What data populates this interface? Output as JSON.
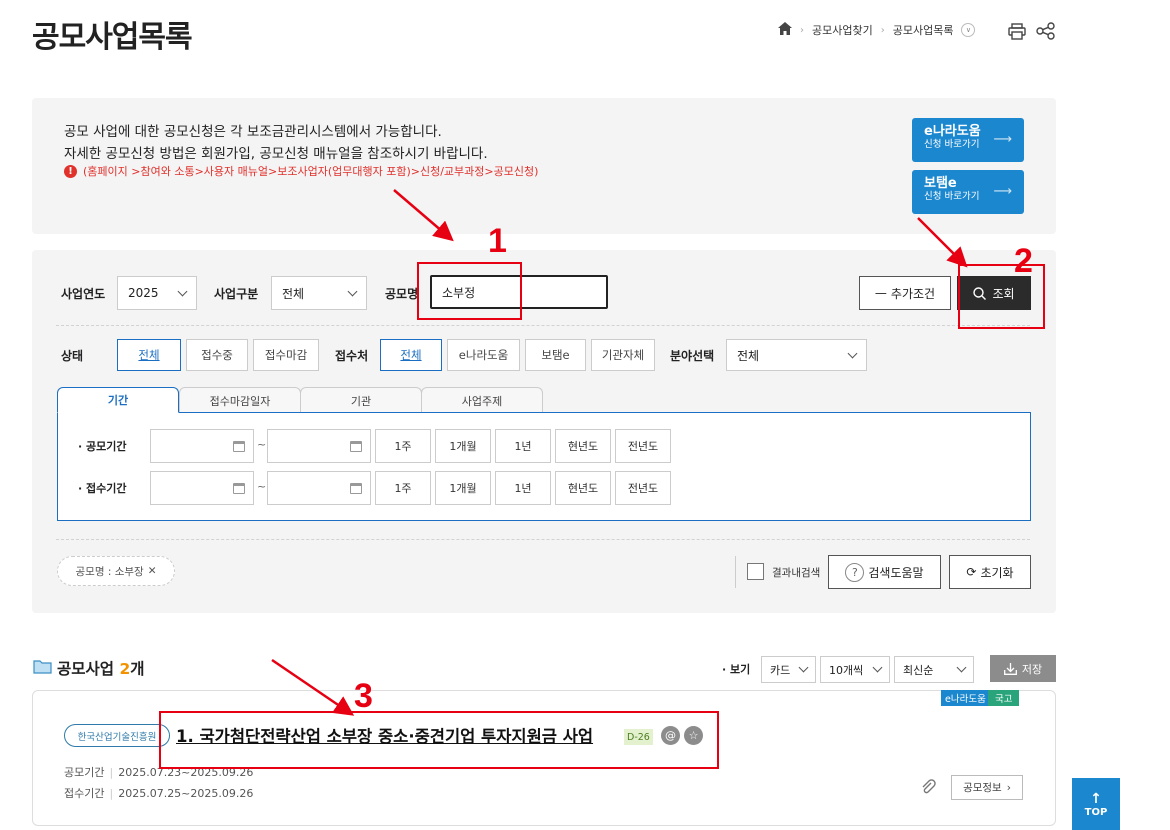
{
  "page": {
    "title": "공모사업목록",
    "breadcrumb": [
      "공모사업찾기",
      "공모사업목록"
    ]
  },
  "notice": {
    "line1": "공모 사업에 대한 공모신청은 각 보조금관리시스템에서 가능합니다.",
    "line2": "자세한 공모신청 방법은 회원가입, 공모신청 매뉴얼을 참조하시기 바랍니다.",
    "warn": "(홈페이지 >참여와 소통>사용자 매뉴얼>보조사업자(업무대행자 포함)>신청/교부과정>공모신청)",
    "systems": [
      {
        "name": "e나라도움",
        "sub": "신청 바로가기"
      },
      {
        "name": "보탬e",
        "sub": "신청 바로가기"
      }
    ]
  },
  "search": {
    "year_label": "사업연도",
    "year_value": "2025",
    "type_label": "사업구분",
    "type_value": "전체",
    "name_label": "공모명",
    "name_value": "소부정",
    "add_cond": "추가조건",
    "search_btn": "조회",
    "status_label": "상태",
    "status_opts": [
      "전체",
      "접수중",
      "접수마감"
    ],
    "receiver_label": "접수처",
    "receiver_opts": [
      "전체",
      "e나라도움",
      "보탬e",
      "기관자체"
    ],
    "field_label": "분야선택",
    "field_value": "전체",
    "tabs": [
      "기간",
      "접수마감일자",
      "기관",
      "사업주제"
    ],
    "period_rows": [
      "공모기간",
      "접수기간"
    ],
    "period_sep": "~",
    "period_btns": [
      "1주",
      "1개월",
      "1년",
      "현년도",
      "전년도"
    ],
    "cond_chip": "공모명 : 소부장",
    "within_results": "결과내검색",
    "help_btn": "검색도움말",
    "reset_btn": "초기화"
  },
  "results": {
    "label": "공모사업",
    "count": "2",
    "count_unit": "개",
    "view_label": "· 보기",
    "view_mode": "카드",
    "page_size": "10개씩",
    "sort": "최신순",
    "save": "저장"
  },
  "card": {
    "tags": [
      "e나라도움",
      "국고"
    ],
    "org": "한국산업기술진흥원",
    "title": "1. 국가첨단전략산업 소부장 중소·중견기업 투자지원금 사업",
    "dday": "D-26",
    "period_label": "공모기간",
    "period": "2025.07.23~2025.09.26",
    "recv_label": "접수기간",
    "recv": "2025.07.25~2025.09.26",
    "info_btn": "공모정보"
  },
  "top_btn": "TOP",
  "annotations": [
    "1",
    "2",
    "3"
  ],
  "colors": {
    "accent": "#1b87cf",
    "annotation": "#e60012",
    "count": "#f39200"
  }
}
